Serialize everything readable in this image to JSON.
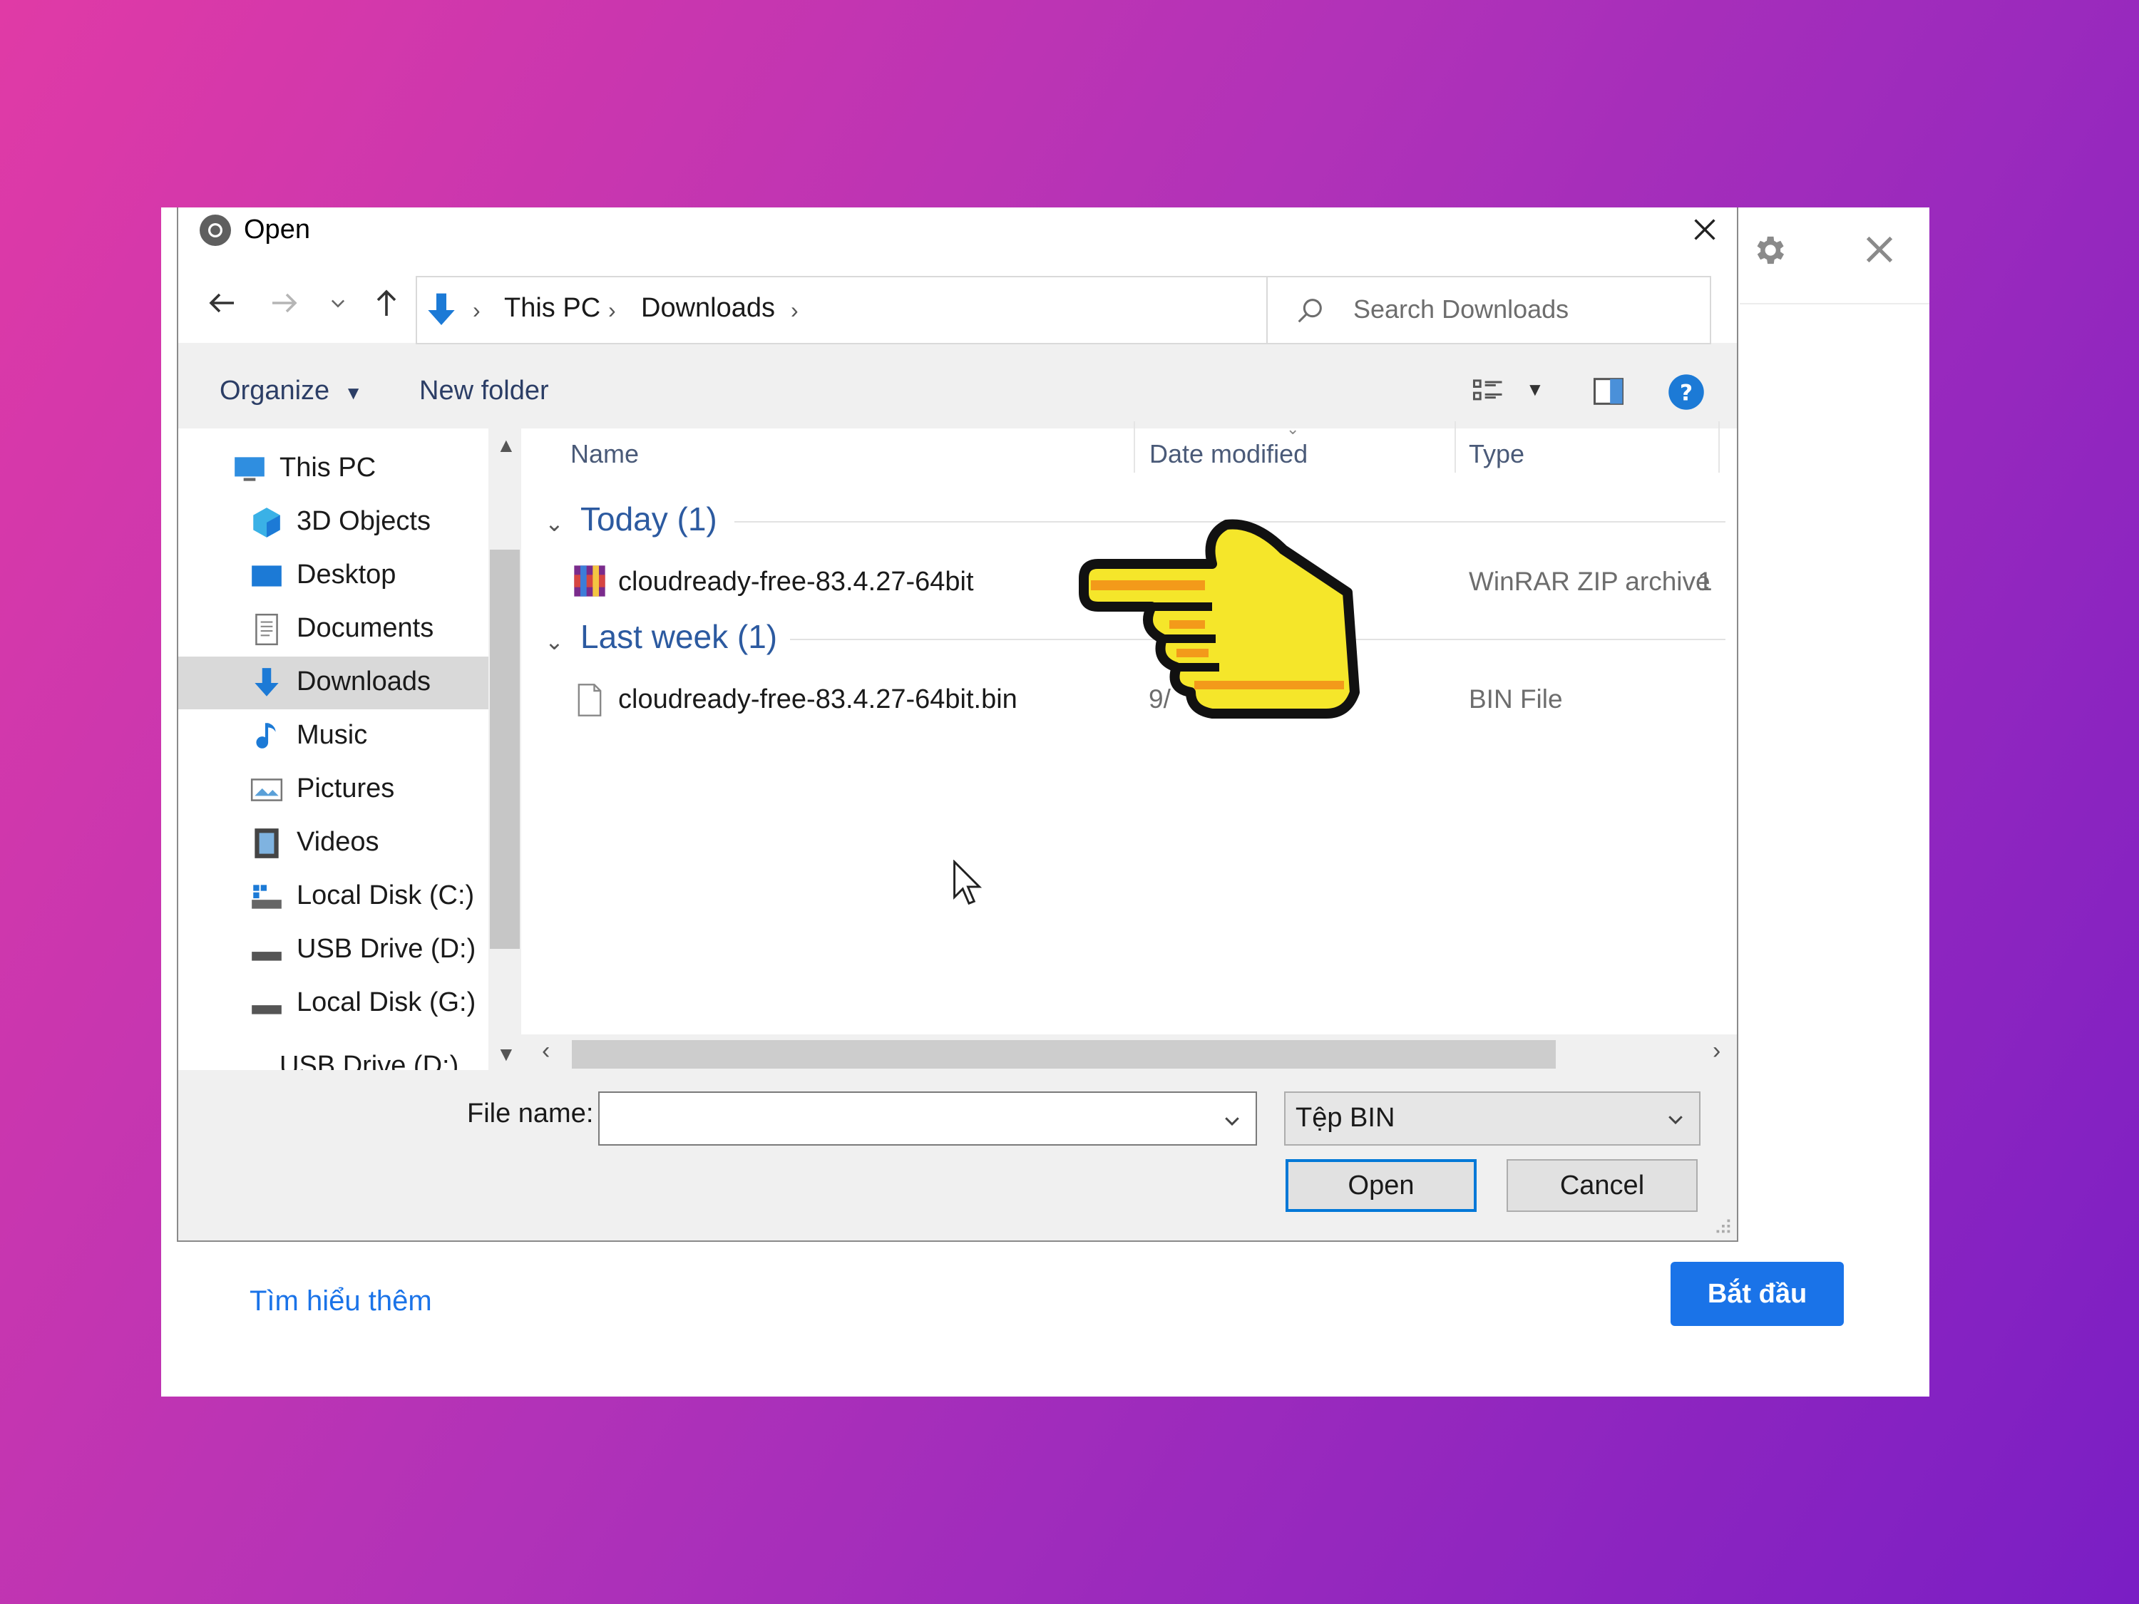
{
  "panel": {
    "learn_more": "Tìm hiểu thêm",
    "start_button": "Bắt đầu"
  },
  "dialog": {
    "title": "Open",
    "breadcrumb": [
      "This PC",
      "Downloads"
    ],
    "search_placeholder": "Search Downloads",
    "toolbar": {
      "organize": "Organize",
      "new_folder": "New folder"
    },
    "nav_items": [
      {
        "label": "This PC",
        "icon": "computer-icon"
      },
      {
        "label": "3D Objects",
        "icon": "3d-objects-icon"
      },
      {
        "label": "Desktop",
        "icon": "desktop-icon"
      },
      {
        "label": "Documents",
        "icon": "documents-icon"
      },
      {
        "label": "Downloads",
        "icon": "downloads-icon",
        "selected": true
      },
      {
        "label": "Music",
        "icon": "music-icon"
      },
      {
        "label": "Pictures",
        "icon": "pictures-icon"
      },
      {
        "label": "Videos",
        "icon": "videos-icon"
      },
      {
        "label": "Local Disk (C:)",
        "icon": "local-disk-icon"
      },
      {
        "label": "USB Drive (D:)",
        "icon": "usb-drive-icon"
      },
      {
        "label": "Local Disk (G:)",
        "icon": "local-disk-icon"
      },
      {
        "label": "USB Drive (D:)",
        "icon": "usb-drive-icon"
      }
    ],
    "columns": {
      "name": "Name",
      "date": "Date modified",
      "type": "Type"
    },
    "groups": [
      {
        "label": "Today (1)",
        "files": [
          {
            "name": "cloudready-free-83.4.27-64bit",
            "date_partial": "1",
            "type": "WinRAR ZIP archive",
            "icon": "winrar-icon"
          }
        ]
      },
      {
        "label": "Last week (1)",
        "files": [
          {
            "name": "cloudready-free-83.4.27-64bit.bin",
            "date_partial": "9/",
            "type": "BIN File",
            "icon": "file-icon"
          }
        ]
      }
    ],
    "file_name_label": "File name:",
    "file_name_value": "",
    "file_type_value": "Tệp BIN",
    "open_button": "Open",
    "cancel_button": "Cancel"
  },
  "colors": {
    "accent": "#1a73e8",
    "folder_blue": "#0078d7",
    "pointer_yellow": "#f5e62a"
  }
}
